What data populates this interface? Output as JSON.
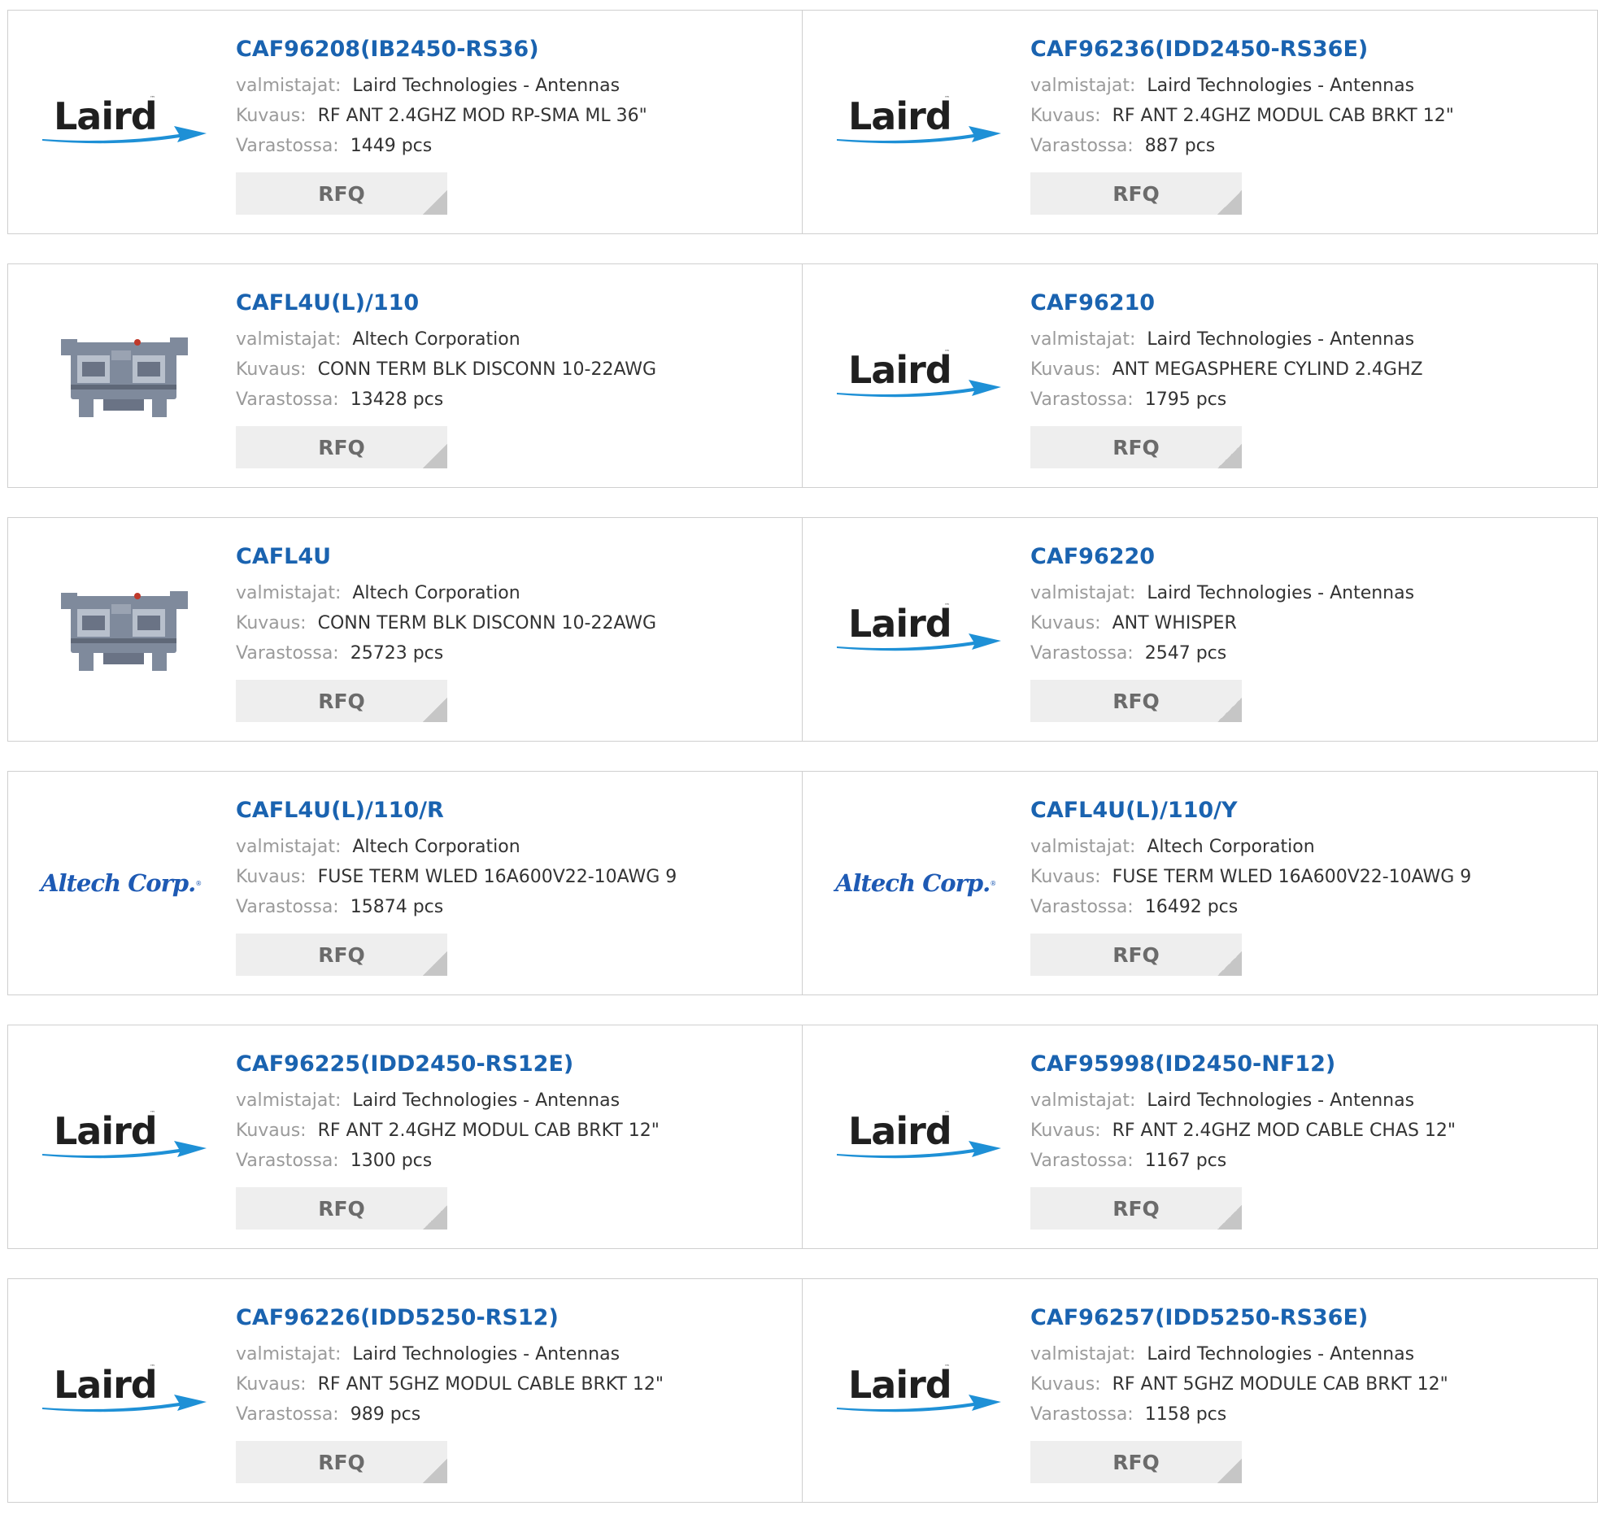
{
  "labels": {
    "manufacturer": "valmistajat:",
    "description": "Kuvaus:",
    "stock": "Varastossa:",
    "rfq": "RFQ"
  },
  "logos": {
    "laird": {
      "text": "Laird",
      "tm": "™"
    },
    "altech": {
      "text": "Altech Corp.",
      "reg": "®"
    },
    "colors": {
      "link": "#1a63b0",
      "laird_swoosh": "#1e90d6",
      "altech": "#1e5ab4",
      "terminal_block": "#7f8a9c"
    }
  },
  "products": [
    {
      "part": "CAF96208(IB2450-RS36)",
      "logo": "laird",
      "manufacturer": "Laird Technologies - Antennas",
      "description": "RF ANT 2.4GHZ MOD RP-SMA ML 36\"",
      "stock": "1449 pcs"
    },
    {
      "part": "CAF96236(IDD2450-RS36E)",
      "logo": "laird",
      "manufacturer": "Laird Technologies - Antennas",
      "description": "RF ANT 2.4GHZ MODUL CAB BRKT 12\"",
      "stock": "887 pcs"
    },
    {
      "part": "CAFL4U(L)/110",
      "logo": "terminal",
      "manufacturer": "Altech Corporation",
      "description": "CONN TERM BLK DISCONN 10-22AWG",
      "stock": "13428 pcs"
    },
    {
      "part": "CAF96210",
      "logo": "laird",
      "manufacturer": "Laird Technologies - Antennas",
      "description": "ANT MEGASPHERE CYLIND 2.4GHZ",
      "stock": "1795 pcs"
    },
    {
      "part": "CAFL4U",
      "logo": "terminal",
      "manufacturer": "Altech Corporation",
      "description": "CONN TERM BLK DISCONN 10-22AWG",
      "stock": "25723 pcs"
    },
    {
      "part": "CAF96220",
      "logo": "laird",
      "manufacturer": "Laird Technologies - Antennas",
      "description": "ANT WHISPER",
      "stock": "2547 pcs"
    },
    {
      "part": "CAFL4U(L)/110/R",
      "logo": "altech",
      "manufacturer": "Altech Corporation",
      "description": "FUSE TERM WLED 16A600V22-10AWG 9",
      "stock": "15874 pcs"
    },
    {
      "part": "CAFL4U(L)/110/Y",
      "logo": "altech",
      "manufacturer": "Altech Corporation",
      "description": "FUSE TERM WLED 16A600V22-10AWG 9",
      "stock": "16492 pcs"
    },
    {
      "part": "CAF96225(IDD2450-RS12E)",
      "logo": "laird",
      "manufacturer": "Laird Technologies - Antennas",
      "description": "RF ANT 2.4GHZ MODUL CAB BRKT 12\"",
      "stock": "1300 pcs"
    },
    {
      "part": "CAF95998(ID2450-NF12)",
      "logo": "laird",
      "manufacturer": "Laird Technologies - Antennas",
      "description": "RF ANT 2.4GHZ MOD CABLE CHAS 12\"",
      "stock": "1167 pcs"
    },
    {
      "part": "CAF96226(IDD5250-RS12)",
      "logo": "laird",
      "manufacturer": "Laird Technologies - Antennas",
      "description": "RF ANT 5GHZ MODUL CABLE BRKT 12\"",
      "stock": "989 pcs"
    },
    {
      "part": "CAF96257(IDD5250-RS36E)",
      "logo": "laird",
      "manufacturer": "Laird Technologies - Antennas",
      "description": "RF ANT 5GHZ MODULE CAB BRKT 12\"",
      "stock": "1158 pcs"
    }
  ]
}
